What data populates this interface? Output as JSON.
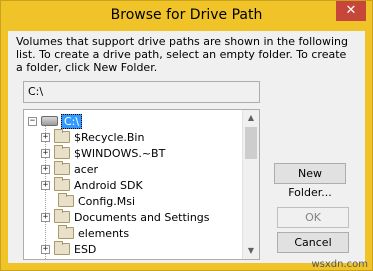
{
  "window": {
    "title": "Browse for Drive Path",
    "close_glyph": "✕",
    "title_bar_color": "#f0c428"
  },
  "description": "Volumes that support drive paths are shown in the following list. To create a drive path, select an empty folder. To create a folder, click New Folder.",
  "path_field": {
    "value": "C:\\"
  },
  "tree": {
    "root": {
      "expander": "−",
      "label": "C:\\",
      "icon": "drive-icon",
      "selected": true
    },
    "items": [
      {
        "label": "$Recycle.Bin",
        "expander": "+"
      },
      {
        "label": "$WINDOWS.~BT",
        "expander": "+"
      },
      {
        "label": "acer",
        "expander": "+"
      },
      {
        "label": "Android SDK",
        "expander": "+"
      },
      {
        "label": "Config.Msi",
        "expander": ""
      },
      {
        "label": "Documents and Settings",
        "expander": "+"
      },
      {
        "label": "elements",
        "expander": ""
      },
      {
        "label": "ESD",
        "expander": "+"
      }
    ]
  },
  "scrollbar": {
    "up_glyph": "▲",
    "down_glyph": "▼"
  },
  "buttons": {
    "new_folder": "New Folder...",
    "ok": "OK",
    "cancel": "Cancel"
  },
  "watermark": "wsxdn.com"
}
